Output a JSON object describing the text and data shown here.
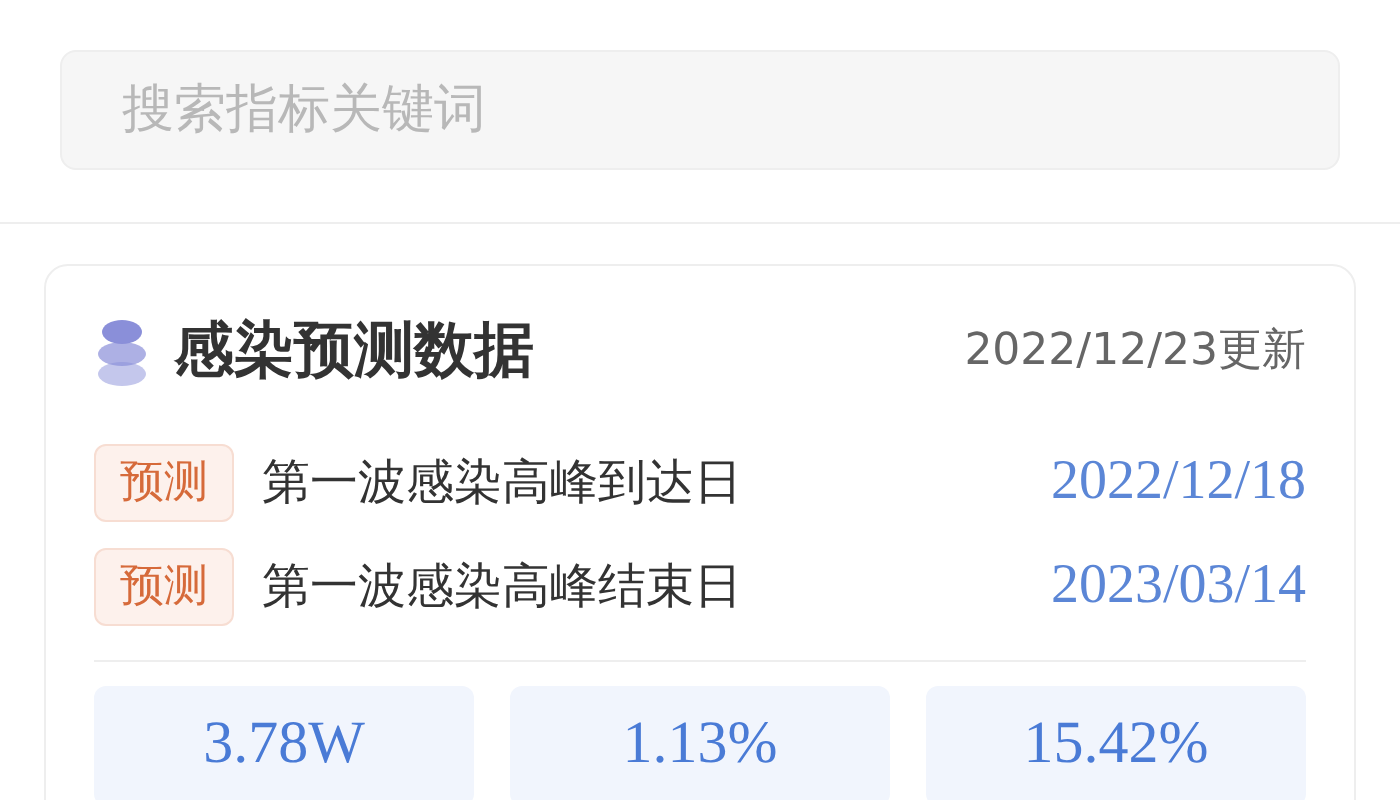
{
  "search": {
    "placeholder": "搜索指标关键词"
  },
  "card": {
    "title": "感染预测数据",
    "updated": "2022/12/23更新",
    "rows": [
      {
        "tag": "预测",
        "label": "第一波感染高峰到达日",
        "date": "2022/12/18"
      },
      {
        "tag": "预测",
        "label": "第一波感染高峰结束日",
        "date": "2023/03/14"
      }
    ],
    "stats": [
      {
        "value": "3.78W"
      },
      {
        "value": "1.13%"
      },
      {
        "value": "15.42%"
      }
    ]
  }
}
